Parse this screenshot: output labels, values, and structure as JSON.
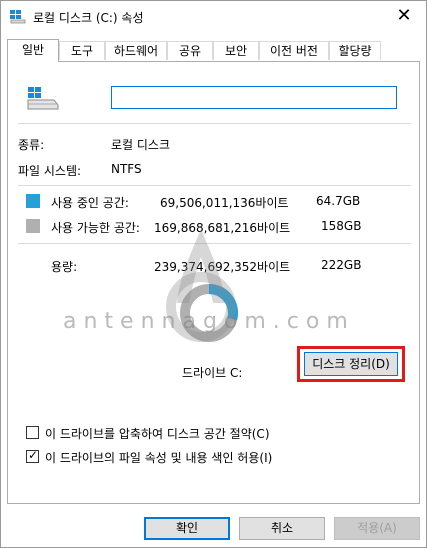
{
  "window": {
    "title": "로컬 디스크 (C:) 속성",
    "close_glyph": "✕"
  },
  "tabs": [
    {
      "label": "일반",
      "active": true
    },
    {
      "label": "도구"
    },
    {
      "label": "하드웨어"
    },
    {
      "label": "공유"
    },
    {
      "label": "보안"
    },
    {
      "label": "이전 버전"
    },
    {
      "label": "할당량"
    }
  ],
  "general": {
    "name_value": "",
    "type_label": "종류:",
    "type_value": "로컬 디스크",
    "fs_label": "파일 시스템:",
    "fs_value": "NTFS",
    "used_label": "사용 중인 공간:",
    "used_bytes": "69,506,011,136바이트",
    "used_size": "64.7GB",
    "free_label": "사용 가능한 공간:",
    "free_bytes": "169,868,681,216바이트",
    "free_size": "158GB",
    "capacity_label": "용량:",
    "capacity_bytes": "239,374,692,352바이트",
    "capacity_size": "222GB",
    "drive_label": "드라이브 C:",
    "cleanup_button": "디스크 정리(D)",
    "compress_label": "이 드라이브를 압축하여 디스크 공간 절약(C)",
    "compress_checked": false,
    "index_label": "이 드라이브의 파일 속성 및 내용 색인 허용(I)",
    "index_checked": true,
    "used_fraction": 0.29
  },
  "colors": {
    "used": "#26a0da",
    "free": "#b0b0b0",
    "accent": "#0078d7",
    "highlight": "#e01919"
  },
  "buttons": {
    "ok": "확인",
    "cancel": "취소",
    "apply": "적용(A)"
  },
  "watermark": {
    "text": "antennagom.com"
  },
  "icons": {
    "title": "drive-icon",
    "drive": "drive-icon",
    "close": "close-icon"
  }
}
